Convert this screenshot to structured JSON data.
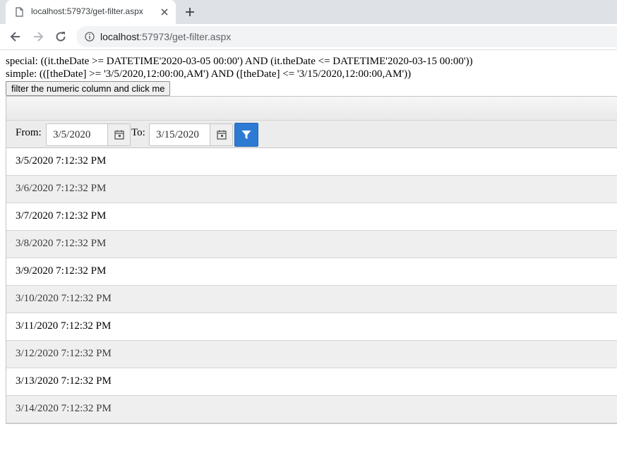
{
  "browser": {
    "tab_title": "localhost:57973/get-filter.aspx",
    "url_host": "localhost",
    "url_rest": ":57973/get-filter.aspx",
    "icons": {
      "tab": "document-icon",
      "close": "close-icon",
      "new_tab": "plus-icon",
      "back": "back-arrow-icon",
      "forward": "forward-arrow-icon",
      "reload": "reload-icon",
      "info": "info-icon"
    }
  },
  "page": {
    "special_text": "special: ((it.theDate >= DATETIME'2020-03-05 00:00') AND (it.theDate <= DATETIME'2020-03-15 00:00'))",
    "simple_text": "simple: (([theDate] >= '3/5/2020,12:00:00,AM') AND ([theDate] <= '3/15/2020,12:00:00,AM'))",
    "button_label": "filter the numeric column and click me"
  },
  "grid": {
    "filter": {
      "from_label": "From:",
      "from_value": "3/5/2020",
      "to_label": "To:",
      "to_value": "3/15/2020",
      "icons": {
        "calendar": "calendar-icon",
        "filter": "filter-icon"
      }
    },
    "rows": [
      "3/5/2020 7:12:32 PM",
      "3/6/2020 7:12:32 PM",
      "3/7/2020 7:12:32 PM",
      "3/8/2020 7:12:32 PM",
      "3/9/2020 7:12:32 PM",
      "3/10/2020 7:12:32 PM",
      "3/11/2020 7:12:32 PM",
      "3/12/2020 7:12:32 PM",
      "3/13/2020 7:12:32 PM",
      "3/14/2020 7:12:32 PM"
    ]
  },
  "colors": {
    "accent": "#2d7ad3",
    "tabstrip": "#dee1e6",
    "alt_row": "#efefef"
  }
}
